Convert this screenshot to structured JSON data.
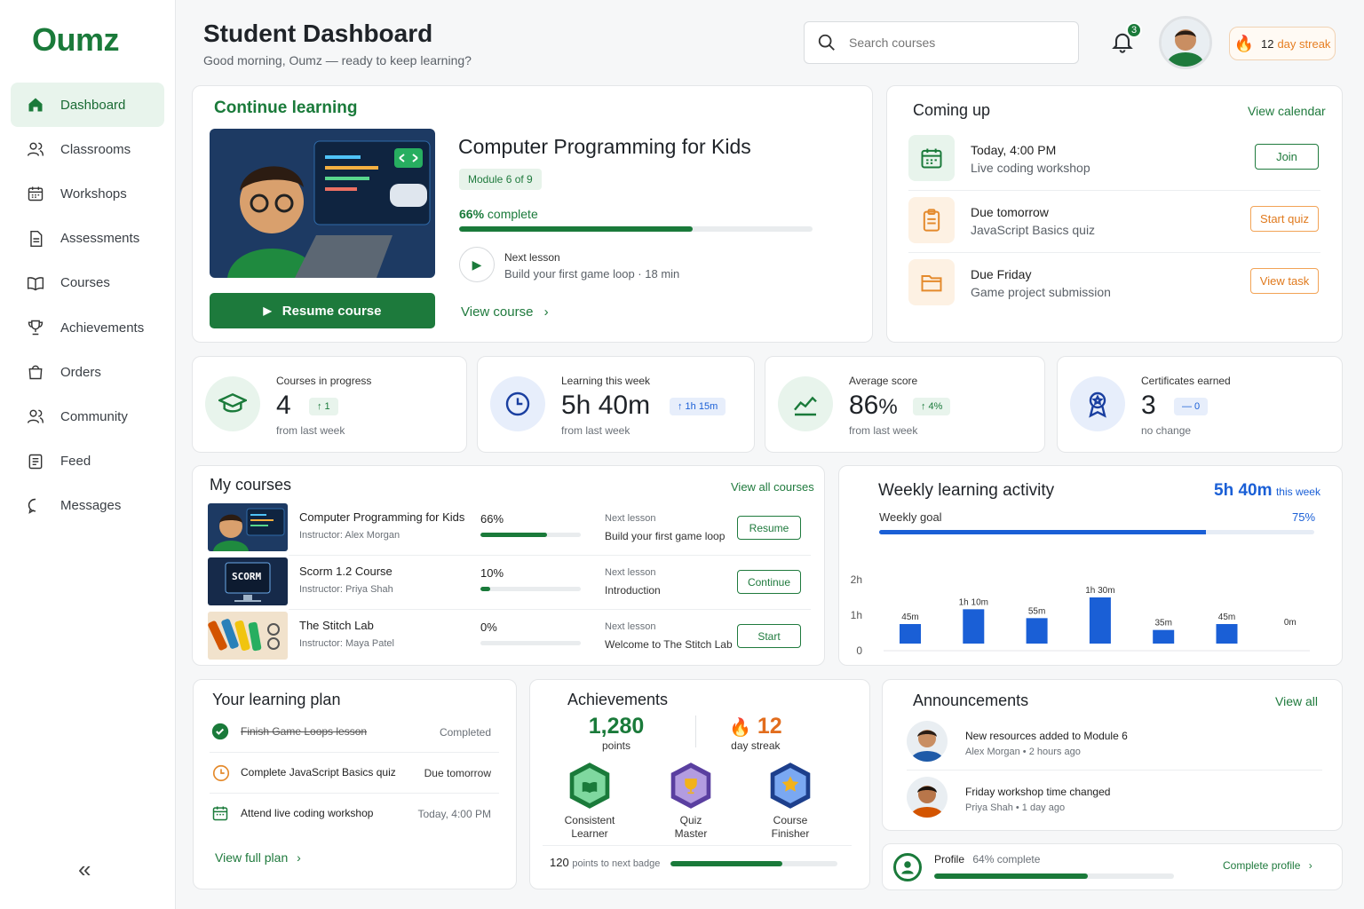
{
  "app": {
    "logo": "Oumz"
  },
  "nav": [
    {
      "label": "Dashboard",
      "icon": "home-icon",
      "active": true
    },
    {
      "label": "Classrooms",
      "icon": "users-icon"
    },
    {
      "label": "Workshops",
      "icon": "calendar-icon"
    },
    {
      "label": "Assessments",
      "icon": "document-icon"
    },
    {
      "label": "Courses",
      "icon": "book-icon"
    },
    {
      "label": "Achievements",
      "icon": "trophy-icon"
    },
    {
      "label": "Orders",
      "icon": "bag-icon"
    },
    {
      "label": "Community",
      "icon": "users-icon"
    },
    {
      "label": "Feed",
      "icon": "feed-icon"
    },
    {
      "label": "Messages",
      "icon": "chat-icon"
    }
  ],
  "collapse_glyph": "«",
  "header": {
    "title": "Student Dashboard",
    "greeting": "Good morning, Oumz — ready to keep learning?",
    "search_placeholder": "Search courses",
    "notifications": "3",
    "streak_count": "12",
    "streak_label": "day streak"
  },
  "continue": {
    "heading": "Continue learning",
    "course": "Computer Programming for Kids",
    "module": "Module 6 of 9",
    "pct": "66%",
    "pct_suffix": "complete",
    "progress": 0.66,
    "next_label": "Next lesson",
    "next_lesson": "Build your first game loop",
    "next_duration": "18 min",
    "resume": "Resume course",
    "view": "View course"
  },
  "coming_up": {
    "heading": "Coming up",
    "view_calendar": "View calendar",
    "items": [
      {
        "when": "Today, 4:00 PM",
        "what": "Live coding workshop",
        "action": "Join",
        "icon": "calendar-icon"
      },
      {
        "when": "Due tomorrow",
        "what": "JavaScript Basics quiz",
        "action": "Start quiz",
        "icon": "clipboard-icon"
      },
      {
        "when": "Due Friday",
        "what": "Game project submission",
        "action": "View task",
        "icon": "folder-icon"
      }
    ]
  },
  "stats": [
    {
      "label": "Courses in progress",
      "value": "4",
      "delta": "↑ 1",
      "foot": "from last week",
      "icon": "graduation-cap-icon"
    },
    {
      "label": "Learning this week",
      "value": "5h 40m",
      "delta": "↑ 1h 15m",
      "foot": "from last week",
      "icon": "clock-icon"
    },
    {
      "label": "Average score",
      "value": "86",
      "unit": "%",
      "delta": "↑ 4%",
      "foot": "from last week",
      "icon": "trend-icon"
    },
    {
      "label": "Certificates earned",
      "value": "3",
      "delta": "— 0",
      "foot": "no change",
      "icon": "ribbon-icon"
    }
  ],
  "my_courses": {
    "heading": "My courses",
    "view_all": "View all courses",
    "next_label": "Next lesson",
    "instructor_prefix": "Instructor:",
    "rows": [
      {
        "title": "Computer Programming for Kids",
        "instructor": "Alex Morgan",
        "pct": "66%",
        "progress": 0.66,
        "next": "Build your first game loop",
        "action": "Resume",
        "thumb": "coding"
      },
      {
        "title": "Scorm 1.2 Course",
        "instructor": "Priya Shah",
        "pct": "10%",
        "progress": 0.1,
        "next": "Introduction",
        "action": "Continue",
        "thumb": "scorm",
        "thumb_text": "SCORM"
      },
      {
        "title": "The Stitch Lab",
        "instructor": "Maya Patel",
        "pct": "0%",
        "progress": 0,
        "next": "Welcome to The Stitch Lab",
        "action": "Start",
        "thumb": "stitch"
      }
    ]
  },
  "weekly": {
    "heading": "Weekly learning activity",
    "total": "5h 40m",
    "total_suffix": "this week",
    "goal_label": "Weekly goal",
    "goal_pct": "75%",
    "goal_progress": 0.75
  },
  "chart_data": {
    "type": "bar",
    "categories": [
      "Mon",
      "Tue",
      "Wed",
      "Thu",
      "Fri",
      "Sat",
      "Sun"
    ],
    "values": [
      45,
      70,
      55,
      90,
      35,
      45,
      0
    ],
    "data_labels": [
      "45m",
      "1h 10m",
      "55m",
      "1h 30m",
      "35m",
      "45m",
      "0m"
    ],
    "y_ticks": [
      "0",
      "1h",
      "2h"
    ],
    "ylim": [
      0,
      120
    ],
    "color": "#1a5fd6"
  },
  "plan": {
    "heading": "Your learning plan",
    "items": [
      {
        "text": "Finish Game Loops lesson",
        "status": "Completed",
        "done": true,
        "icon": "check-circle-icon"
      },
      {
        "text": "Complete JavaScript Basics quiz",
        "status": "Due tomorrow",
        "icon": "clock-icon"
      },
      {
        "text": "Attend live coding workshop",
        "status": "Today, 4:00 PM",
        "icon": "calendar-icon"
      }
    ],
    "view_full": "View full plan"
  },
  "achievements": {
    "heading": "Achievements",
    "points": "1,280",
    "points_label": "points",
    "streak": "12",
    "streak_label": "day streak",
    "badges": [
      {
        "line1": "Consistent",
        "line2": "Learner",
        "icon": "book-badge-icon"
      },
      {
        "line1": "Quiz",
        "line2": "Master",
        "icon": "trophy-badge-icon"
      },
      {
        "line1": "Course",
        "line2": "Finisher",
        "icon": "star-badge-icon"
      }
    ],
    "to_next": "120",
    "to_next_label": "points to next badge",
    "to_next_progress": 0.67
  },
  "announcements": {
    "heading": "Announcements",
    "view_all": "View all",
    "items": [
      {
        "title": "New resources added to Module 6",
        "author": "Alex Morgan",
        "time": "2 hours ago"
      },
      {
        "title": "Friday workshop time changed",
        "author": "Priya Shah",
        "time": "1 day ago"
      }
    ]
  },
  "profile": {
    "label": "Profile",
    "pct": "64% complete",
    "progress": 0.64,
    "cta": "Complete profile"
  }
}
